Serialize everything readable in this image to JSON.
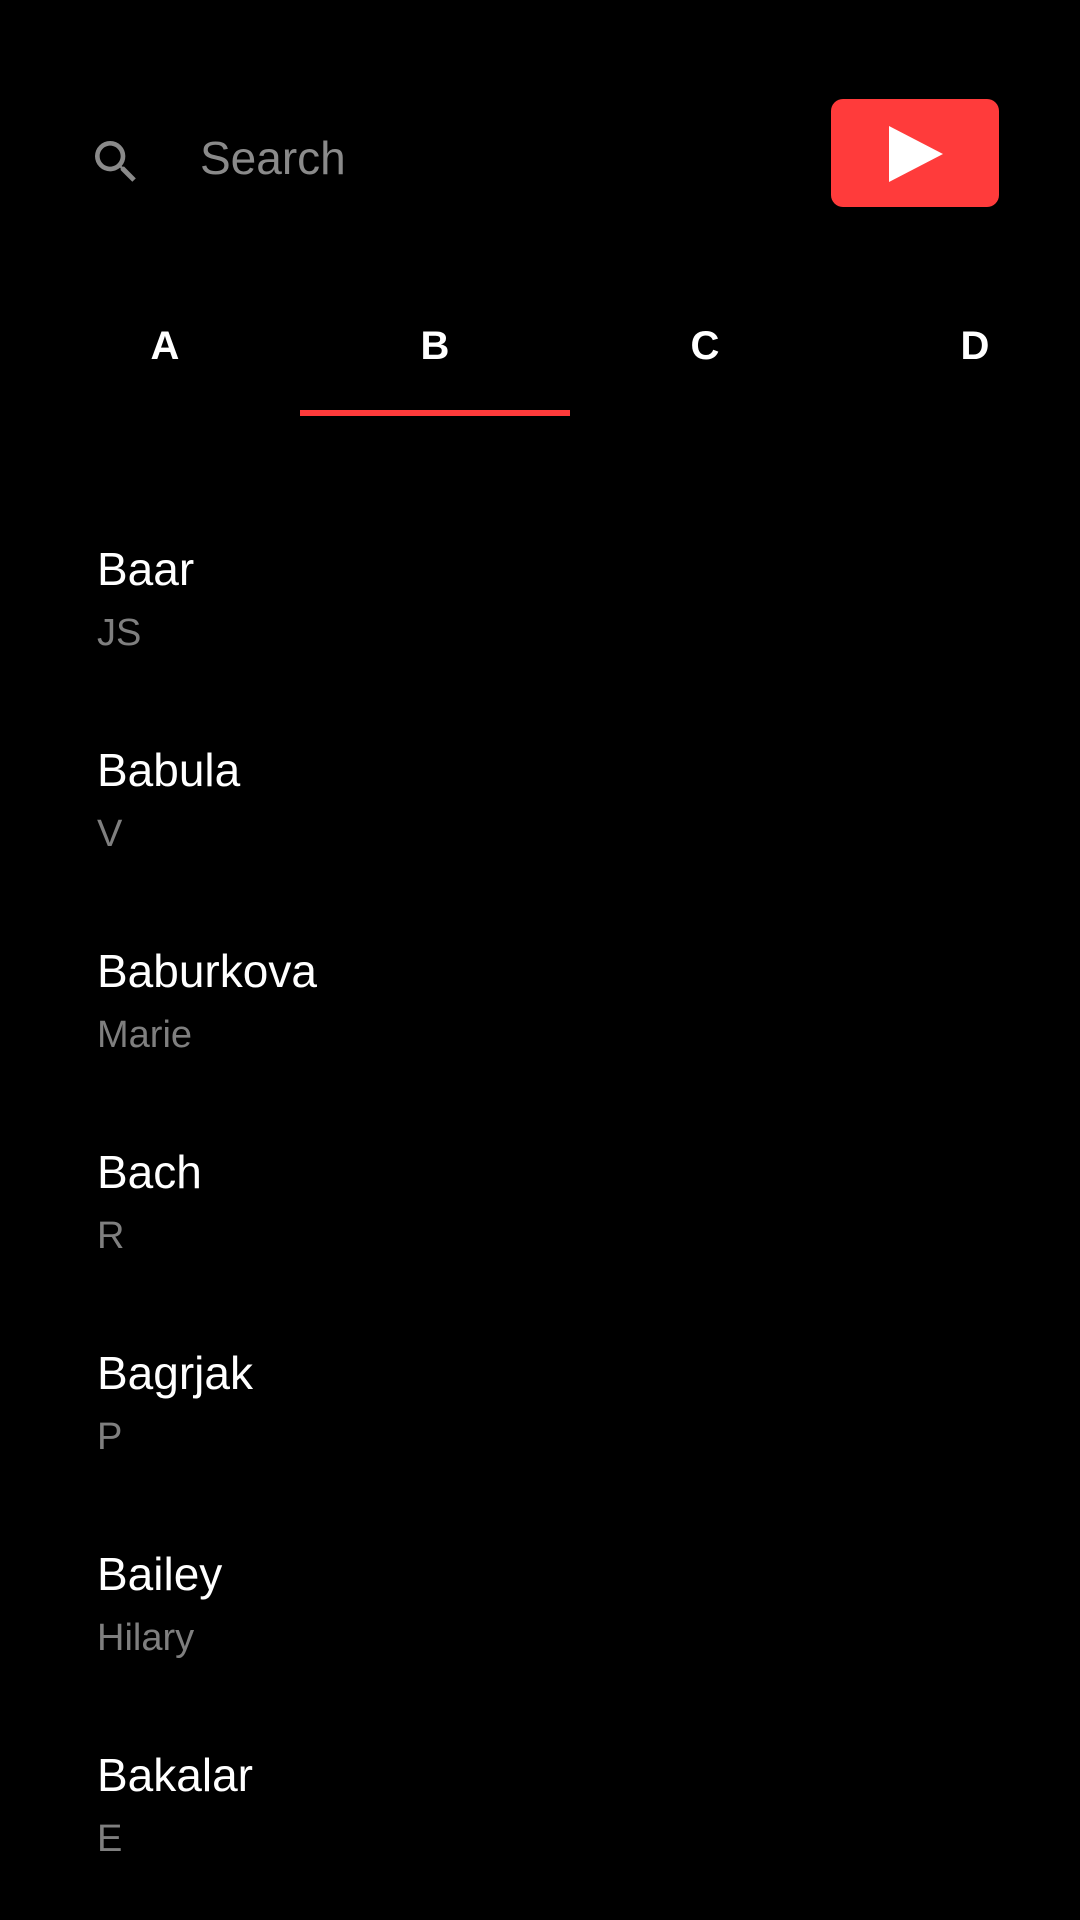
{
  "search": {
    "placeholder": "Search",
    "value": ""
  },
  "play_button": {
    "icon": "play-icon",
    "color": "#ff3b3b"
  },
  "tabs": [
    {
      "label": "A",
      "selected": false
    },
    {
      "label": "B",
      "selected": true
    },
    {
      "label": "C",
      "selected": false
    },
    {
      "label": "D",
      "selected": false
    }
  ],
  "accent_color": "#ff3b3b",
  "list": {
    "items": [
      {
        "title": "Baar",
        "subtitle": "JS"
      },
      {
        "title": "Babula",
        "subtitle": "V"
      },
      {
        "title": "Baburkova",
        "subtitle": "Marie"
      },
      {
        "title": "Bach",
        "subtitle": "R"
      },
      {
        "title": "Bagrjak",
        "subtitle": "P"
      },
      {
        "title": "Bailey",
        "subtitle": "Hilary"
      },
      {
        "title": "Bakalar",
        "subtitle": "E"
      }
    ]
  }
}
